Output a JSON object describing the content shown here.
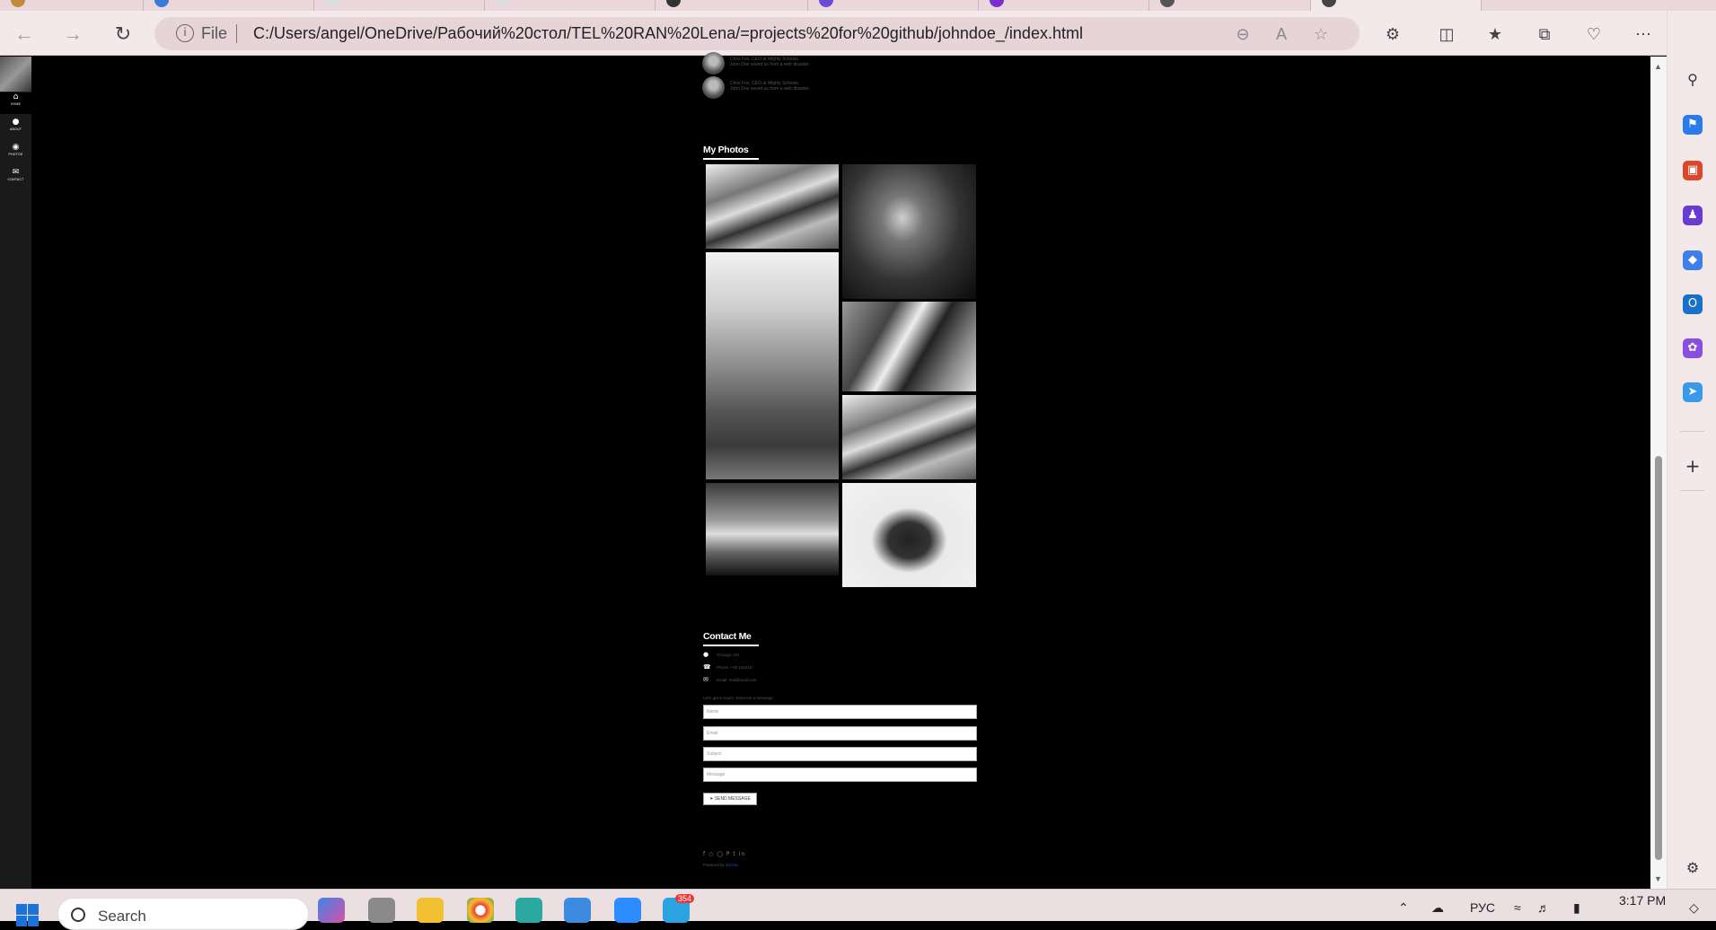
{
  "browser": {
    "address": {
      "scheme_label": "File",
      "url": "C:/Users/angel/OneDrive/Рабочий%20стол/TEL%20RAN%20Lena/=projects%20for%20github/johndoe_/index.html"
    },
    "icons": {
      "back": "back-arrow-icon",
      "forward": "forward-arrow-icon",
      "reload": "reload-icon",
      "info": "info-icon",
      "zoom": "zoom-out-icon",
      "read_aloud": "read-aloud-icon",
      "favorite": "star-icon",
      "extensions": "puzzle-icon",
      "split": "split-screen-icon",
      "favorites": "favorites-icon",
      "collections": "collections-icon",
      "health": "browser-essentials-icon",
      "more": "more-icon",
      "copilot": "copilot-icon"
    }
  },
  "site": {
    "sidebar": {
      "items": [
        {
          "label": "HOME",
          "icon": "home-icon"
        },
        {
          "label": "ABOUT",
          "icon": "user-icon"
        },
        {
          "label": "PHOTOS",
          "icon": "eye-icon"
        },
        {
          "label": "CONTACT",
          "icon": "envelope-icon"
        }
      ]
    },
    "testimonials": [
      {
        "author": "Chris Fox. CEO at Mighty Schools.",
        "quote": "John Doe saved us from a web disaster."
      },
      {
        "author": "Chris Fox. CEO at Mighty Schools.",
        "quote": "John Doe saved us from a web disaster."
      }
    ],
    "photos": {
      "title": "My Photos"
    },
    "contact": {
      "title": "Contact Me",
      "location": "Chicago, US",
      "phone": "Phone: +00 151515",
      "email": "Email: mail@mail.com",
      "intro": "Let's get in touch. Send me a message:",
      "fields": {
        "name": "Name",
        "email": "Email",
        "subject": "Subject",
        "message": "Message"
      },
      "send_label": "SEND MESSAGE"
    },
    "footer": {
      "powered_prefix": "Powered by",
      "powered_link": "w3.css"
    }
  },
  "taskbar": {
    "search_label": "Search",
    "language": "РУС",
    "time": "3:17 PM",
    "badge_count": "354"
  },
  "colors": {
    "page_bg": "#000000",
    "chrome_bg": "#f3e9eb",
    "taskbar_bg": "#ecdfe2",
    "accent_blue": "#1a73d9"
  }
}
